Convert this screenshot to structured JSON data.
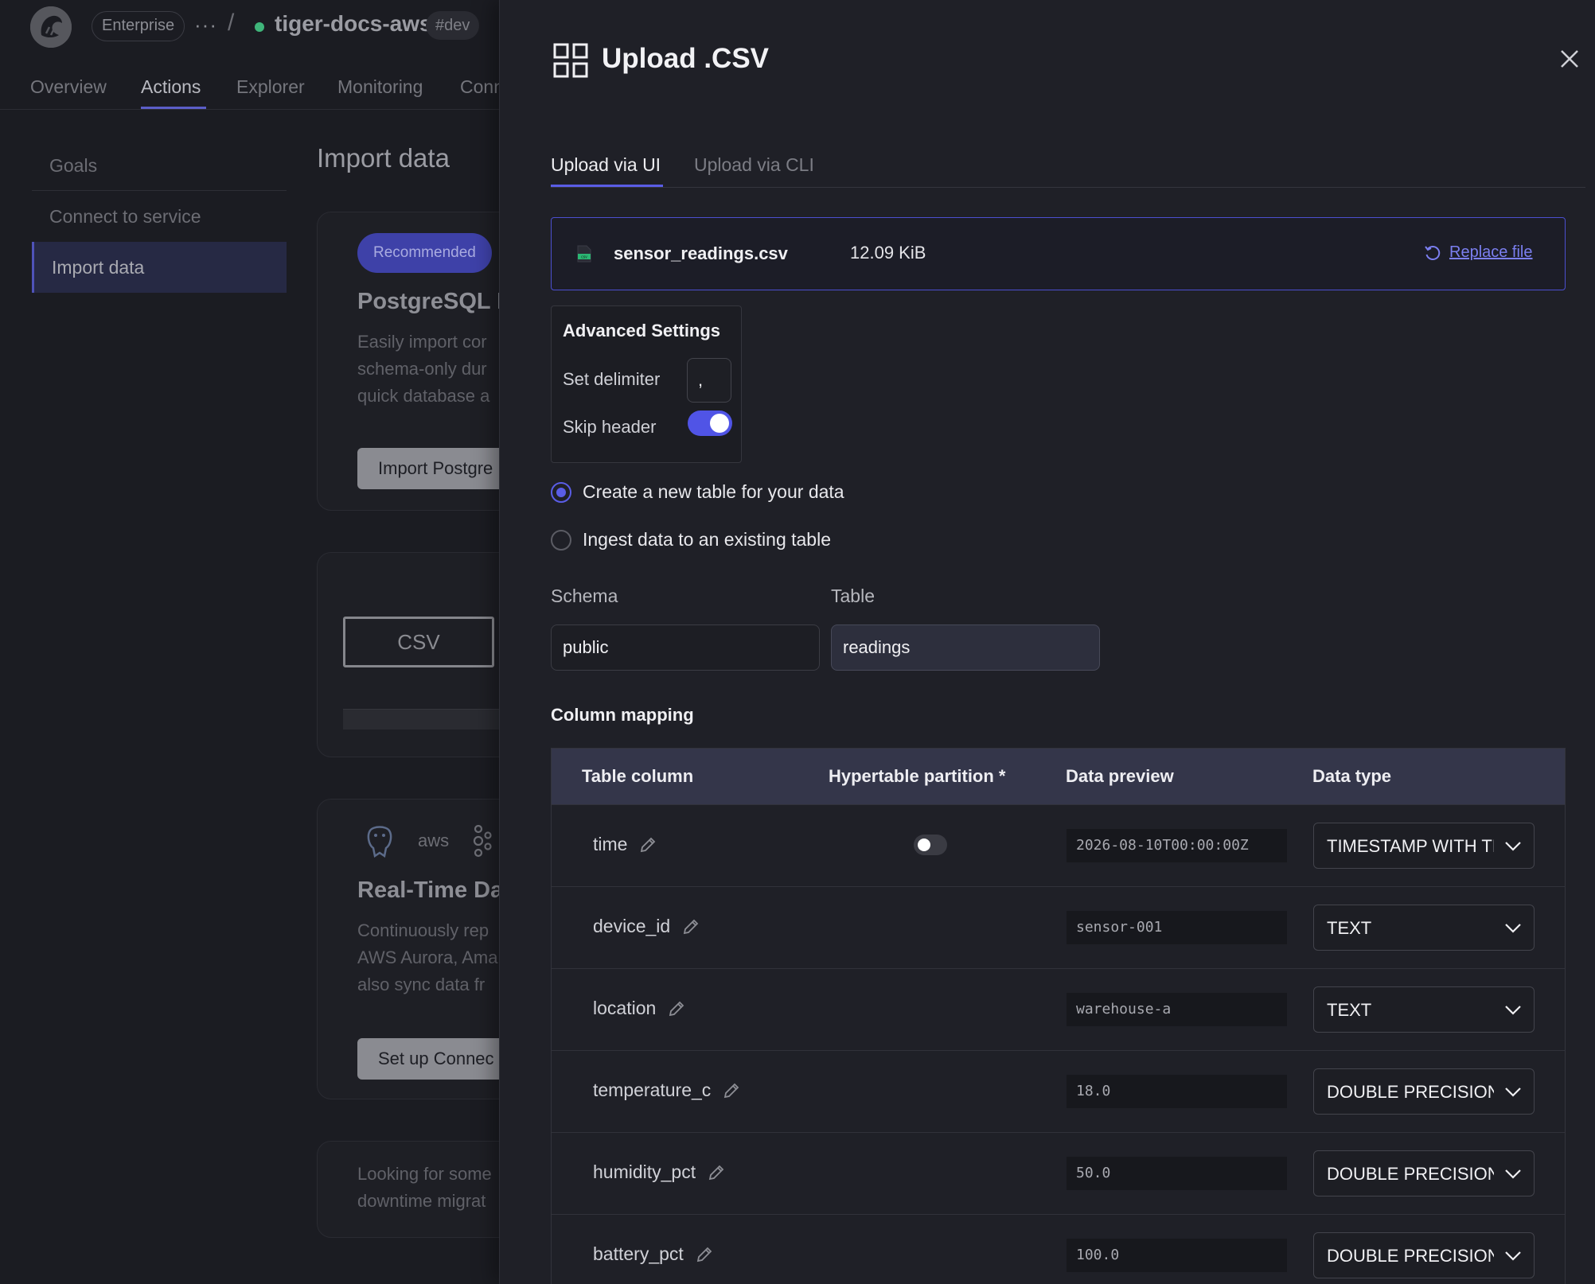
{
  "topbar": {
    "org_pill": "Enterprise",
    "more_dots": "···",
    "separator": "/",
    "project_name": "tiger-docs-aws",
    "env_tag": "#dev"
  },
  "nav": {
    "tabs": [
      "Overview",
      "Actions",
      "Explorer",
      "Monitoring",
      "Conn"
    ],
    "active": "Actions"
  },
  "sidebar": {
    "items": [
      {
        "label": "Goals"
      },
      {
        "label": "Connect to service"
      },
      {
        "label": "Import data"
      }
    ]
  },
  "main": {
    "title": "Import data",
    "card1": {
      "badge": "Recommended",
      "title": "PostgreSQL I",
      "desc": [
        "Easily import cor",
        "schema-only dur",
        "quick database a"
      ],
      "button": "Import Postgre"
    },
    "card2": {
      "csv_label": "CSV"
    },
    "card3": {
      "logo_aws": "aws",
      "title": "Real-Time Da",
      "desc": [
        "Continuously rep",
        "AWS Aurora, Ama",
        "also sync data fr"
      ],
      "button": "Set up Connec"
    },
    "card4": {
      "desc": [
        "Looking for some",
        "downtime migrat"
      ]
    }
  },
  "modal": {
    "title": "Upload .CSV",
    "tabs": [
      "Upload via UI",
      "Upload via CLI"
    ],
    "active_tab": "Upload via UI",
    "file": {
      "name": "sensor_readings.csv",
      "size": "12.09 KiB",
      "icon_text": "csv",
      "replace_label": "Replace file"
    },
    "advanced": {
      "title": "Advanced Settings",
      "delimiter_label": "Set delimiter",
      "delimiter_value": ",",
      "skip_header_label": "Skip header",
      "skip_header_on": true
    },
    "radio_options": [
      {
        "label": "Create a new table for your data",
        "selected": true
      },
      {
        "label": "Ingest data to an existing table",
        "selected": false
      }
    ],
    "schema": {
      "label": "Schema",
      "value": "public"
    },
    "table": {
      "label": "Table",
      "value": "readings"
    },
    "column_mapping": {
      "title": "Column mapping",
      "headers": [
        "Table column",
        "Hypertable partition *",
        "Data preview",
        "Data type"
      ],
      "rows": [
        {
          "column": "time",
          "partition_toggle": true,
          "preview": "2026-08-10T00:00:00Z",
          "type": "TIMESTAMP WITH TI"
        },
        {
          "column": "device_id",
          "partition_toggle": false,
          "preview": "sensor-001",
          "type": "TEXT"
        },
        {
          "column": "location",
          "partition_toggle": false,
          "preview": "warehouse-a",
          "type": "TEXT"
        },
        {
          "column": "temperature_c",
          "partition_toggle": false,
          "preview": "18.0",
          "type": "DOUBLE PRECISION"
        },
        {
          "column": "humidity_pct",
          "partition_toggle": false,
          "preview": "50.0",
          "type": "DOUBLE PRECISION"
        },
        {
          "column": "battery_pct",
          "partition_toggle": false,
          "preview": "100.0",
          "type": "DOUBLE PRECISION"
        }
      ]
    }
  },
  "colors": {
    "accent": "#5a5de6",
    "modal_bg": "#1f2027",
    "page_bg": "#1b1c22",
    "link": "#7b7ff0"
  }
}
